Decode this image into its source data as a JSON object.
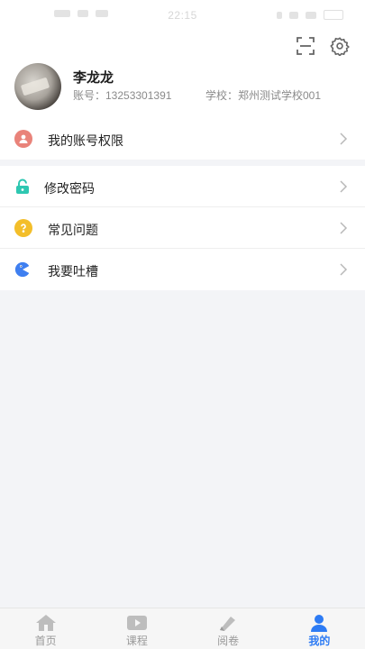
{
  "status_bar": {
    "time": "22:15"
  },
  "profile": {
    "name": "李龙龙",
    "account": "账号：13253301391",
    "school": "学校：郑州测试学校001"
  },
  "menu_group_1": [
    {
      "label": "我的账号权限",
      "icon": "user-icon",
      "color": "#e9837a"
    }
  ],
  "menu_group_2": [
    {
      "label": "修改密码",
      "icon": "lock-icon",
      "color": "#2ec7b1"
    },
    {
      "label": "常见问题",
      "icon": "question-icon",
      "color": "#f3be2a"
    },
    {
      "label": "我要吐槽",
      "icon": "chat-icon",
      "color": "#3f7ff0"
    }
  ],
  "tab_bar": {
    "tabs": [
      {
        "label": "首页",
        "icon": "home-icon"
      },
      {
        "label": "课程",
        "icon": "play-icon"
      },
      {
        "label": "阅卷",
        "icon": "exam-icon"
      },
      {
        "label": "我的",
        "icon": "me-icon",
        "active": true
      }
    ]
  },
  "colors": {
    "accent": "#2d7bf4",
    "background": "#f3f4f7"
  }
}
